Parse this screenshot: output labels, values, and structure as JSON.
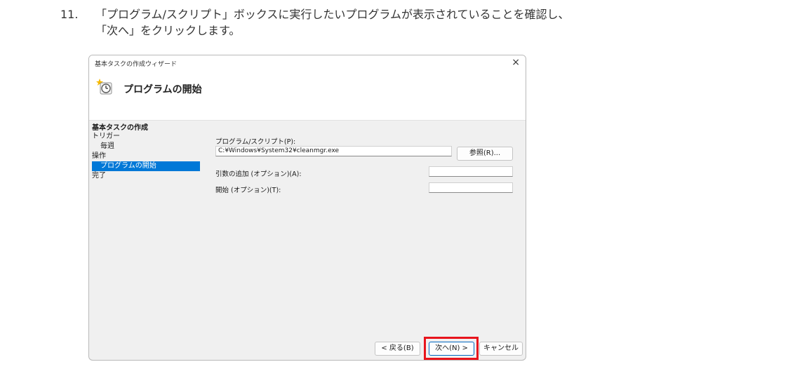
{
  "instruction": {
    "number": "11.",
    "line1": "「プログラム/スクリプト」ボックスに実行したいプログラムが表示されていることを確認し、",
    "line2": "「次へ」をクリックします。"
  },
  "dialog": {
    "title": "基本タスクの作成ウィザード",
    "close_glyph": "×",
    "header_title": "プログラムの開始",
    "nav": {
      "title": "基本タスクの作成",
      "items": [
        {
          "label": "トリガー"
        },
        {
          "label": "毎週"
        },
        {
          "label": "操作"
        },
        {
          "label": "プログラムの開始"
        },
        {
          "label": "完了"
        }
      ]
    },
    "program": {
      "label": "プログラム/スクリプト(P):",
      "value": "C:¥Windows¥System32¥cleanmgr.exe",
      "browse_label": "参照(R)..."
    },
    "args": {
      "label": "引数の追加 (オプション)(A):",
      "value": ""
    },
    "start": {
      "label": "開始 (オプション)(T):",
      "value": ""
    },
    "buttons": {
      "back": "< 戻る(B)",
      "next": "次へ(N) >",
      "cancel": "キャンセル"
    },
    "colors": {
      "selection": "#0078d7",
      "highlight": "#e8141c"
    }
  }
}
